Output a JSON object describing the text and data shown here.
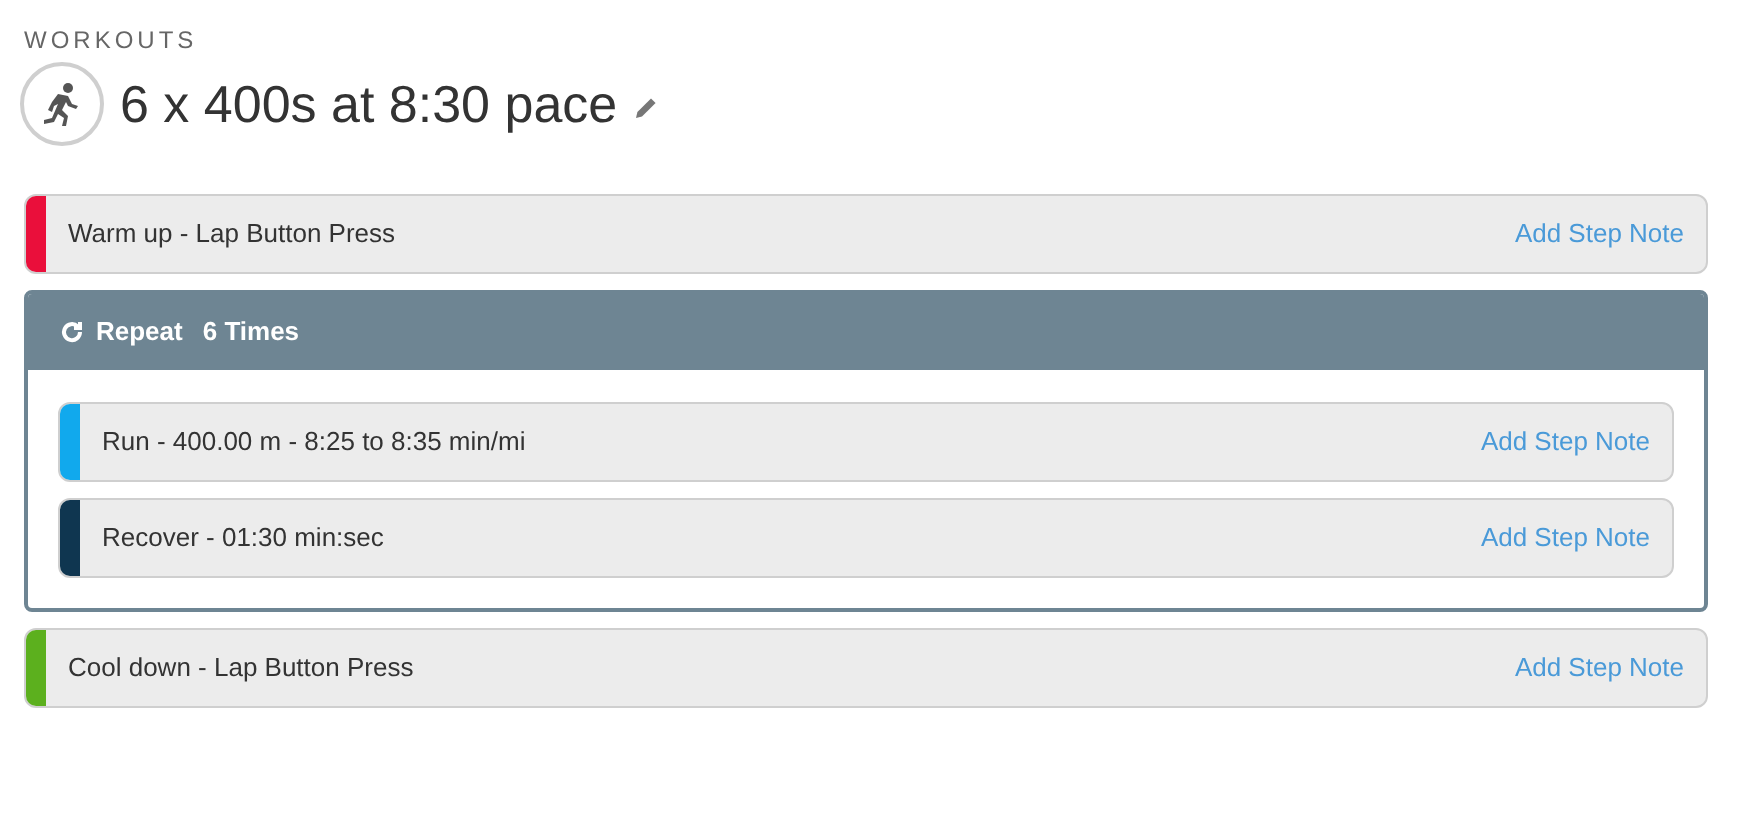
{
  "breadcrumb": "WORKOUTS",
  "title": "6 x 400s at 8:30 pace",
  "steps": [
    {
      "kind": "step",
      "label": "Warm up - Lap Button Press",
      "color": "#ea0f3b",
      "note_link": "Add Step Note"
    },
    {
      "kind": "repeat",
      "label": "Repeat",
      "count": "6 Times",
      "children": [
        {
          "kind": "step",
          "label": "Run - 400.00 m - 8:25 to 8:35 min/mi",
          "color": "#11a9ed",
          "note_link": "Add Step Note"
        },
        {
          "kind": "step",
          "label": "Recover - 01:30 min:sec",
          "color": "#0f3650",
          "note_link": "Add Step Note"
        }
      ]
    },
    {
      "kind": "step",
      "label": "Cool down - Lap Button Press",
      "color": "#5cb01e",
      "note_link": "Add Step Note"
    }
  ]
}
